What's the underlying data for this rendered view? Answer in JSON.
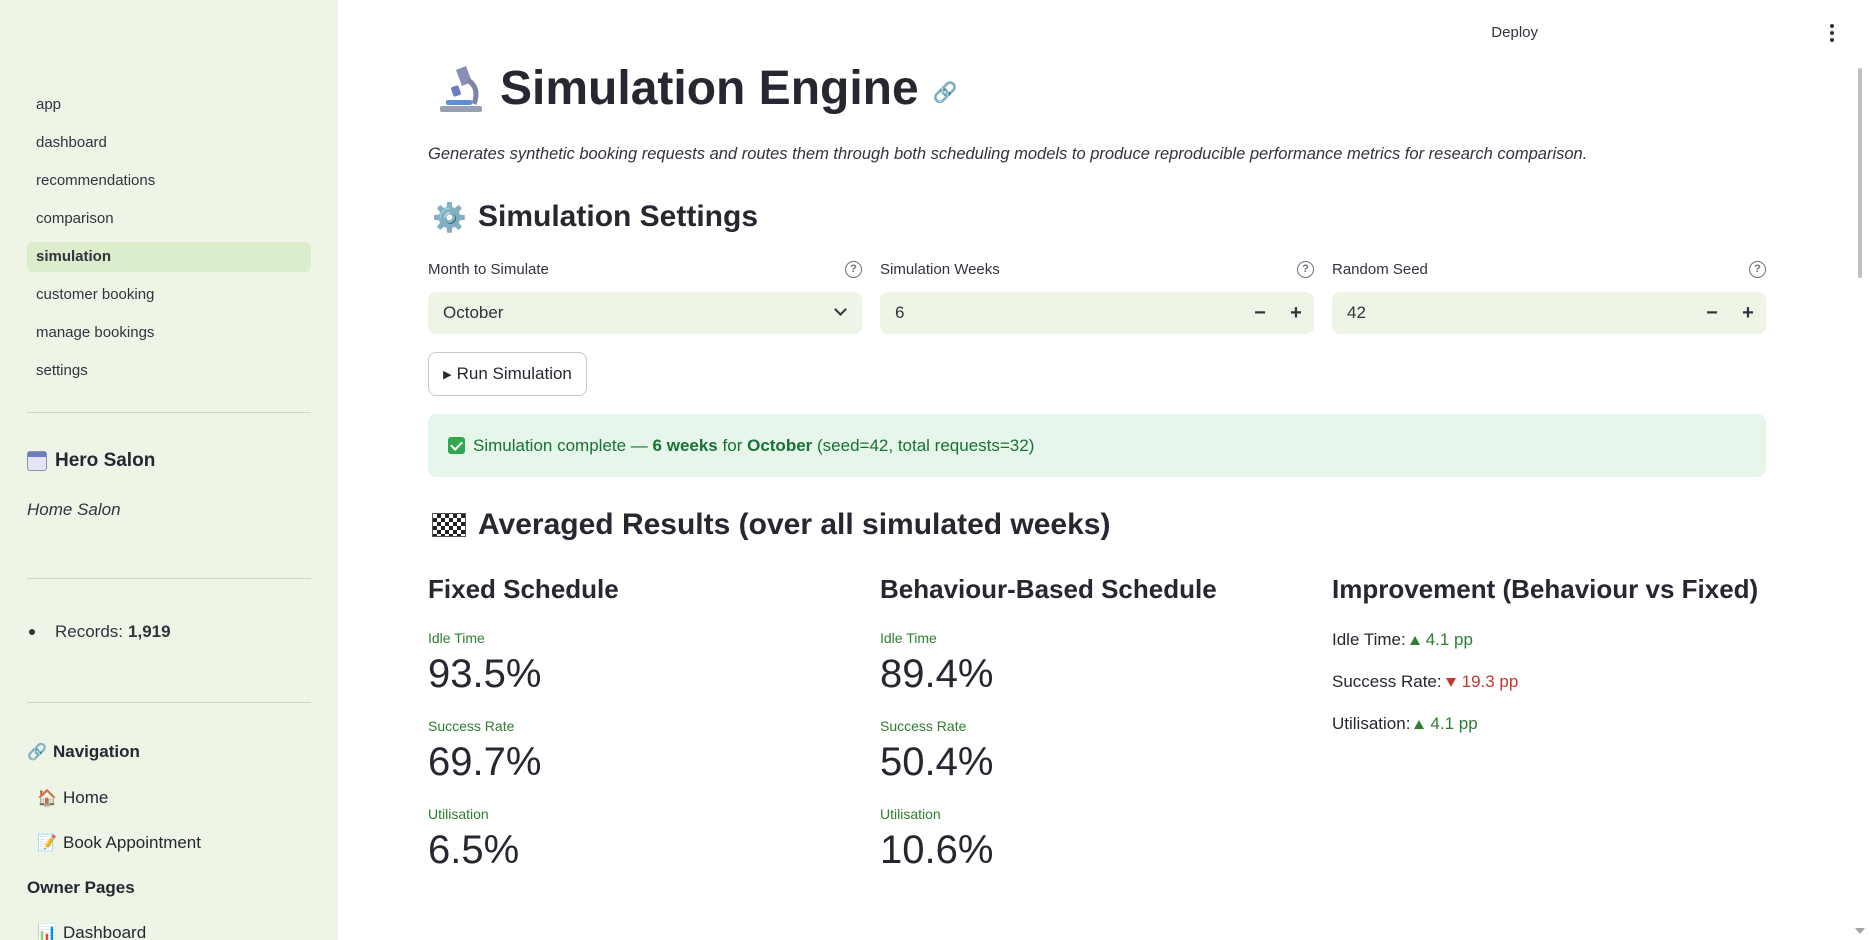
{
  "topbar": {
    "deploy_label": "Deploy"
  },
  "sidebar": {
    "pages": [
      {
        "label": "app",
        "active": false
      },
      {
        "label": "dashboard",
        "active": false
      },
      {
        "label": "recommendations",
        "active": false
      },
      {
        "label": "comparison",
        "active": false
      },
      {
        "label": "simulation",
        "active": true
      },
      {
        "label": "customer booking",
        "active": false
      },
      {
        "label": "manage bookings",
        "active": false
      },
      {
        "label": "settings",
        "active": false
      }
    ],
    "salon_title": "Hero Salon",
    "salon_subtitle": "Home Salon",
    "records_label": "Records:",
    "records_value": "1,919",
    "navigation_heading": "Navigation",
    "nav_home": "Home",
    "nav_book": "Book Appointment",
    "owner_pages_heading": "Owner Pages",
    "owner_dashboard": "Dashboard"
  },
  "main": {
    "title": "Simulation Engine",
    "description": "Generates synthetic booking requests and routes them through both scheduling models to produce reproducible performance metrics for research comparison.",
    "settings_heading": "Simulation Settings",
    "month_label": "Month to Simulate",
    "month_value": "October",
    "weeks_label": "Simulation Weeks",
    "weeks_value": "6",
    "seed_label": "Random Seed",
    "seed_value": "42",
    "run_button": "Run Simulation",
    "success": {
      "prefix": "Simulation complete —",
      "weeks": "6 weeks",
      "for": "for",
      "month": "October",
      "suffix": "(seed=42, total requests=32)"
    },
    "results_heading": "Averaged Results (over all simulated weeks)",
    "fixed": {
      "title": "Fixed Schedule",
      "idle_label": "Idle Time",
      "idle_value": "93.5%",
      "success_label": "Success Rate",
      "success_value": "69.7%",
      "util_label": "Utilisation",
      "util_value": "6.5%"
    },
    "behaviour": {
      "title": "Behaviour-Based Schedule",
      "idle_label": "Idle Time",
      "idle_value": "89.4%",
      "success_label": "Success Rate",
      "success_value": "50.4%",
      "util_label": "Utilisation",
      "util_value": "10.6%"
    },
    "improvement": {
      "title": "Improvement (Behaviour vs Fixed)",
      "idle_label": "Idle Time:",
      "idle_delta": "4.1 pp",
      "success_label": "Success Rate:",
      "success_delta": "19.3 pp",
      "util_label": "Utilisation:",
      "util_delta": "4.1 pp"
    }
  }
}
